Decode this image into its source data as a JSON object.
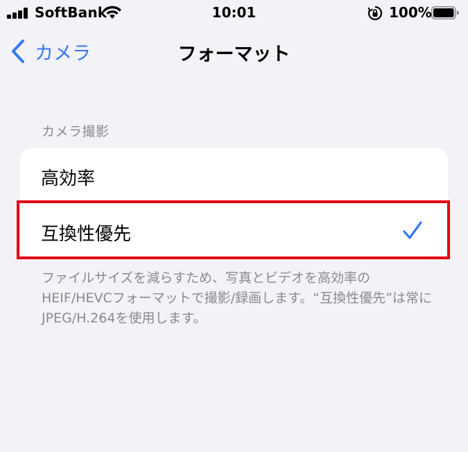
{
  "status_bar": {
    "carrier": "SoftBank",
    "time": "10:01",
    "battery_percent": "100%",
    "battery_level": 1.0,
    "signal_bars": 4
  },
  "nav": {
    "back_label": "カメラ",
    "title": "フォーマット"
  },
  "section": {
    "header": "カメラ撮影",
    "options": [
      {
        "label": "高効率",
        "selected": false
      },
      {
        "label": "互換性優先",
        "selected": true
      }
    ],
    "footer": "ファイルサイズを減らすため、写真とビデオを高効率のHEIF/HEVCフォーマットで撮影/録画します。“互換性優先”は常にJPEG/H.264を使用します。"
  },
  "colors": {
    "accent": "#3478f6",
    "highlight": "#e60012",
    "background": "#f2f2f7",
    "secondary_text": "#8a8a8e"
  },
  "icons": [
    "signal-icon",
    "wifi-icon",
    "rotation-lock-icon",
    "battery-icon",
    "chevron-left-icon",
    "checkmark-icon"
  ]
}
